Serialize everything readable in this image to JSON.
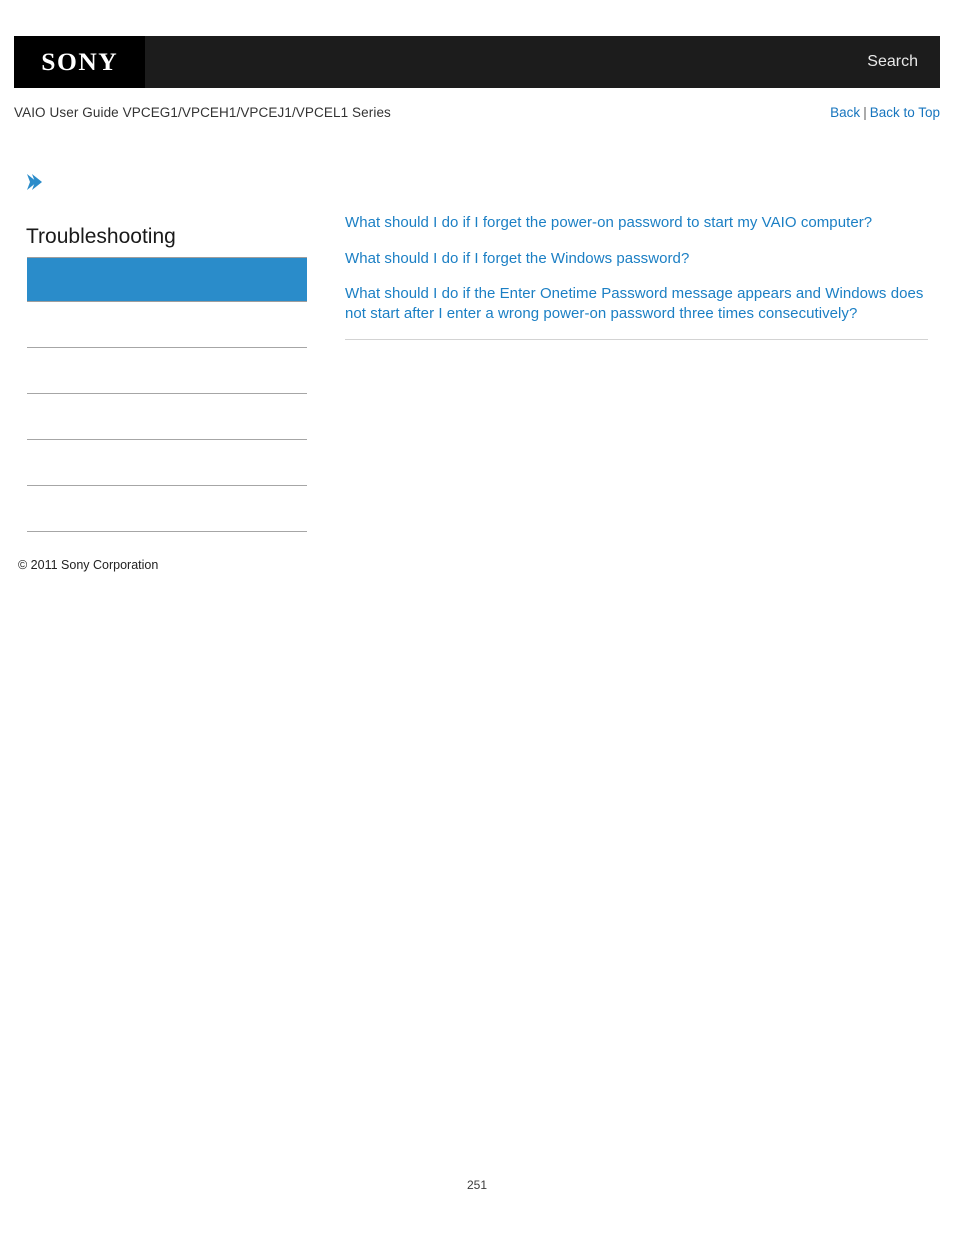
{
  "header": {
    "logo": "SONY",
    "logo_icon": "sony-logo",
    "search_label": "Search"
  },
  "guide_bar": {
    "title": "VAIO User Guide VPCEG1/VPCEH1/VPCEJ1/VPCEL1 Series",
    "back_label": "Back",
    "separator": "|",
    "back_to_top_label": "Back to Top"
  },
  "sidebar": {
    "chevron_icon": "chevron-right-icon",
    "section_title": "Troubleshooting",
    "selected_item": {
      "label": "",
      "highlight_color": "#2a8cca"
    },
    "items": [
      {
        "label": ""
      },
      {
        "label": ""
      },
      {
        "label": ""
      },
      {
        "label": ""
      },
      {
        "label": ""
      }
    ],
    "copyright": "© 2011 Sony Corporation"
  },
  "content": {
    "links": [
      "What should I do if I forget the power-on password to start my VAIO computer?",
      "What should I do if I forget the Windows password?",
      "What should I do if the Enter Onetime Password message appears and Windows does not start after I enter a wrong power-on password three times consecutively?"
    ]
  },
  "footer": {
    "page_number": "251"
  },
  "colors": {
    "topbar_background": "#1c1c1c",
    "logo_background": "#000000",
    "link_blue": "#1b7fc4",
    "nav_link_blue": "#1775be",
    "highlight_blue": "#2a8cca",
    "rule_gray": "#a6a6a6"
  }
}
